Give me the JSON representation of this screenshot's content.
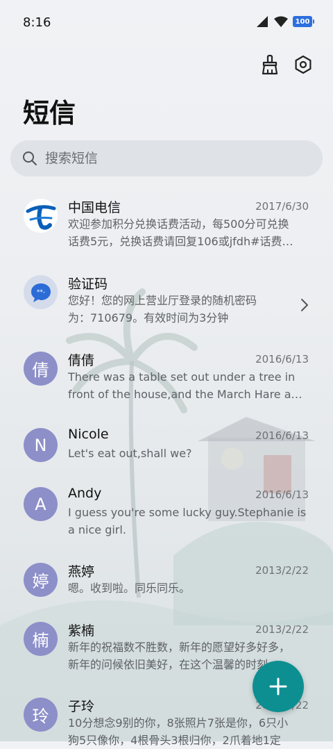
{
  "status": {
    "time": "8:16",
    "battery": "100"
  },
  "header": {
    "title": "短信"
  },
  "search": {
    "placeholder": "搜索短信"
  },
  "messages": [
    {
      "name": "中国电信",
      "date": "2017/6/30",
      "preview_line1": "欢迎参加积分兑换话费活动，每500分可兑换",
      "preview_line2": "话费5元，兑换话费请回复106或jfdh#话费…",
      "avatar": "china-telecom-logo"
    },
    {
      "name": "验证码",
      "date": "",
      "preview_line1": "您好！您的网上营业厅登录的随机密码",
      "preview_line2": "为：710679。有效时间为3分钟",
      "avatar": "message-bubble-icon"
    },
    {
      "name": "倩倩",
      "date": "2016/6/13",
      "initial": "倩",
      "preview_line1": "There was a table set out under a tree in",
      "preview_line2": "front of the house,and the March Hare an…"
    },
    {
      "name": "Nicole",
      "date": "2016/6/13",
      "initial": "N",
      "preview_line1": "Let's eat out,shall we?",
      "preview_line2": ""
    },
    {
      "name": "Andy",
      "date": "2016/6/13",
      "initial": "A",
      "preview_line1": "I guess you're some lucky guy.Stephanie is",
      "preview_line2": "a nice girl."
    },
    {
      "name": "燕婷",
      "date": "2013/2/22",
      "initial": "婷",
      "preview_line1": "嗯。收到啦。同乐同乐。",
      "preview_line2": ""
    },
    {
      "name": "紫楠",
      "date": "2013/2/22",
      "initial": "楠",
      "preview_line1": "新年的祝福数不胜数，新年的愿望好多好多，",
      "preview_line2": "新年的问候依旧美好，在这个温馨的时刻…"
    },
    {
      "name": "子玲",
      "date": "2013/2/22",
      "initial": "玲",
      "preview_line1": "10分想念9别的你，8张照片7张是你，6只小",
      "preview_line2": "狗5只像你，4根骨头3根归你，2爪着地1定"
    }
  ],
  "colors": {
    "accent": "#0d8f92",
    "avatar": "#8d8fc9",
    "battery": "#2d6fdd"
  }
}
